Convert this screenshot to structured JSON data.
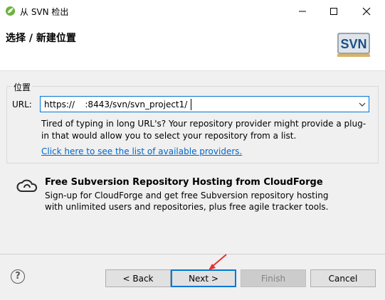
{
  "window": {
    "title": "从 SVN 检出"
  },
  "banner": {
    "heading": "选择 / 新建位置",
    "logo_text": "SVN"
  },
  "location": {
    "group_label": "位置",
    "url_label": "URL:",
    "url_value": "https://      :8443/svn/svn_project1/",
    "hint": "Tired of typing in long URL's?  Your repository provider might provide a plug-in that would allow you to select your repository from a list.",
    "providers_link": "Click here to see the list of available providers."
  },
  "cloudforge": {
    "title": "Free Subversion Repository Hosting from CloudForge",
    "line1": "Sign-up for CloudForge and get free Subversion repository hosting",
    "line2": "with unlimited users and repositories, plus free agile tracker tools."
  },
  "buttons": {
    "help": "?",
    "back": "< Back",
    "next": "Next >",
    "finish": "Finish",
    "cancel": "Cancel"
  },
  "colors": {
    "accent": "#0078d7",
    "link": "#0066cc",
    "annotation": "#e5322d"
  }
}
